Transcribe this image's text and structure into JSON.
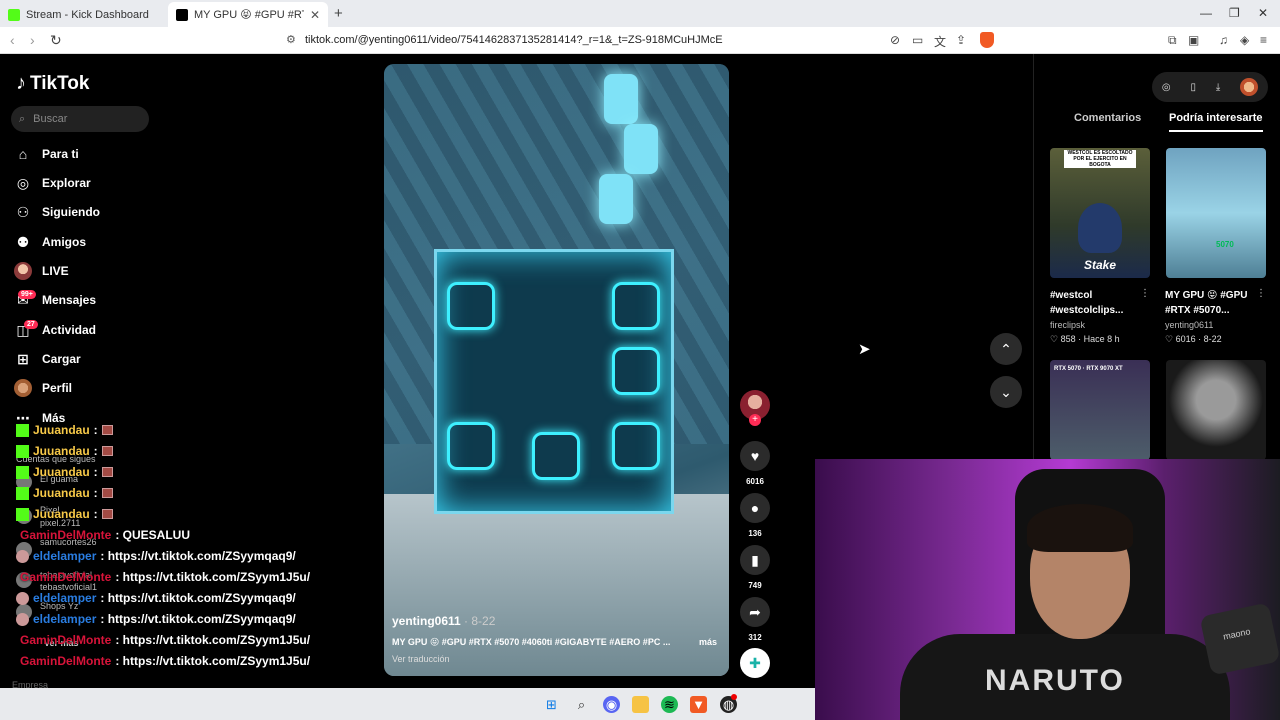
{
  "browser": {
    "tabs": [
      {
        "title": "Stream - Kick Dashboard",
        "active": false
      },
      {
        "title": "MY GPU 😝 #GPU #RTX #5070",
        "active": true
      }
    ],
    "url": "tiktok.com/@yenting0611/video/7541462837135281414?_r=1&_t=ZS-918MCuHJMcE"
  },
  "sidebar": {
    "logo": "TikTok",
    "search_placeholder": "Buscar",
    "menu": [
      {
        "label": "Para ti",
        "icon": "home-icon"
      },
      {
        "label": "Explorar",
        "icon": "compass-icon"
      },
      {
        "label": "Siguiendo",
        "icon": "following-icon"
      },
      {
        "label": "Amigos",
        "icon": "friends-icon"
      },
      {
        "label": "LIVE",
        "icon": "live-icon"
      },
      {
        "label": "Mensajes",
        "icon": "messages-icon",
        "badge": "99+"
      },
      {
        "label": "Actividad",
        "icon": "activity-icon",
        "badge": "27"
      },
      {
        "label": "Cargar",
        "icon": "upload-icon"
      },
      {
        "label": "Perfil",
        "icon": "profile-icon"
      },
      {
        "label": "Más",
        "icon": "more-icon"
      }
    ],
    "following_header": "Cuentas que sigues",
    "following": [
      "El guama",
      "Pixel",
      "pixel.2711",
      "samucortes26",
      "tebastvoficial",
      "tebastvoficial1",
      "Shops Yz"
    ],
    "see_more": "Ver más",
    "footer": "Empresa"
  },
  "chat": [
    {
      "user": "Juuandau",
      "msg": ":",
      "color": "#f7c948",
      "emote": true,
      "platform": "kick"
    },
    {
      "user": "Juuandau",
      "msg": ":",
      "color": "#f7c948",
      "emote": true,
      "platform": "kick"
    },
    {
      "user": "Juuandau",
      "msg": ":",
      "color": "#f7c948",
      "emote": true,
      "platform": "kick"
    },
    {
      "user": "Juuandau",
      "msg": ":",
      "color": "#f7c948",
      "emote": true,
      "platform": "kick"
    },
    {
      "user": "Juuandau",
      "msg": ":",
      "color": "#f7c948",
      "emote": true,
      "platform": "kick"
    },
    {
      "user": "GaminDelMonte",
      "msg": ": QUESALUU",
      "color": "#d8143a",
      "emote": false,
      "platform": "none"
    },
    {
      "user": "eldelamper",
      "msg": ": https://vt.tiktok.com/ZSyymqaq9/",
      "color": "#2a7de1",
      "emote": false,
      "platform": "avatar"
    },
    {
      "user": "GaminDelMonte",
      "msg": ": https://vt.tiktok.com/ZSyym1J5u/",
      "color": "#d8143a",
      "emote": false,
      "platform": "none"
    },
    {
      "user": "eldelamper",
      "msg": ": https://vt.tiktok.com/ZSyymqaq9/",
      "color": "#2a7de1",
      "emote": false,
      "platform": "avatar"
    },
    {
      "user": "eldelamper",
      "msg": ": https://vt.tiktok.com/ZSyymqaq9/",
      "color": "#2a7de1",
      "emote": false,
      "platform": "avatar"
    },
    {
      "user": "GaminDelMonte",
      "msg": ": https://vt.tiktok.com/ZSyym1J5u/",
      "color": "#d8143a",
      "emote": false,
      "platform": "none"
    },
    {
      "user": "GaminDelMonte",
      "msg": ": https://vt.tiktok.com/ZSyym1J5u/",
      "color": "#d8143a",
      "emote": false,
      "platform": "none"
    }
  ],
  "video": {
    "author": "yenting0611",
    "date": "· 8-22",
    "caption": "MY GPU 😝 #GPU #RTX #5070 #4060ti #GIGABYTE #AERO #PC ...",
    "more": "más",
    "translate": "Ver traducción"
  },
  "actions": {
    "likes": "6016",
    "comments": "136",
    "saves": "749",
    "shares": "312"
  },
  "right_panel": {
    "tabs": [
      "Comentarios",
      "Podría interesarte"
    ],
    "active_tab": "Podría interesarte",
    "cards": [
      {
        "title": "#westcol #westcolclips...",
        "author": "fireclipsk",
        "stats": "858 · Hace 8 h",
        "thumb_text": "WESTCOL ES ESCOLTADO POR EL EJERCITO EN BOGOTA",
        "overlay": "Stake"
      },
      {
        "title": "MY GPU 😝 #GPU #RTX #5070...",
        "author": "yenting0611",
        "stats": "6016 · 8-22",
        "thumb_text": "5070",
        "overlay": ""
      },
      {
        "title": "",
        "author": "",
        "stats": "",
        "thumb_text": "RTX 5070 · RTX 9070 XT",
        "overlay": ""
      },
      {
        "title": "",
        "author": "",
        "stats": "",
        "thumb_text": "",
        "overlay": ""
      }
    ]
  },
  "webcam": {
    "shirt_text": "NARUTO",
    "mic_brand": "maono"
  },
  "colors": {
    "accent": "#fe2c55",
    "kick": "#53fc18"
  }
}
